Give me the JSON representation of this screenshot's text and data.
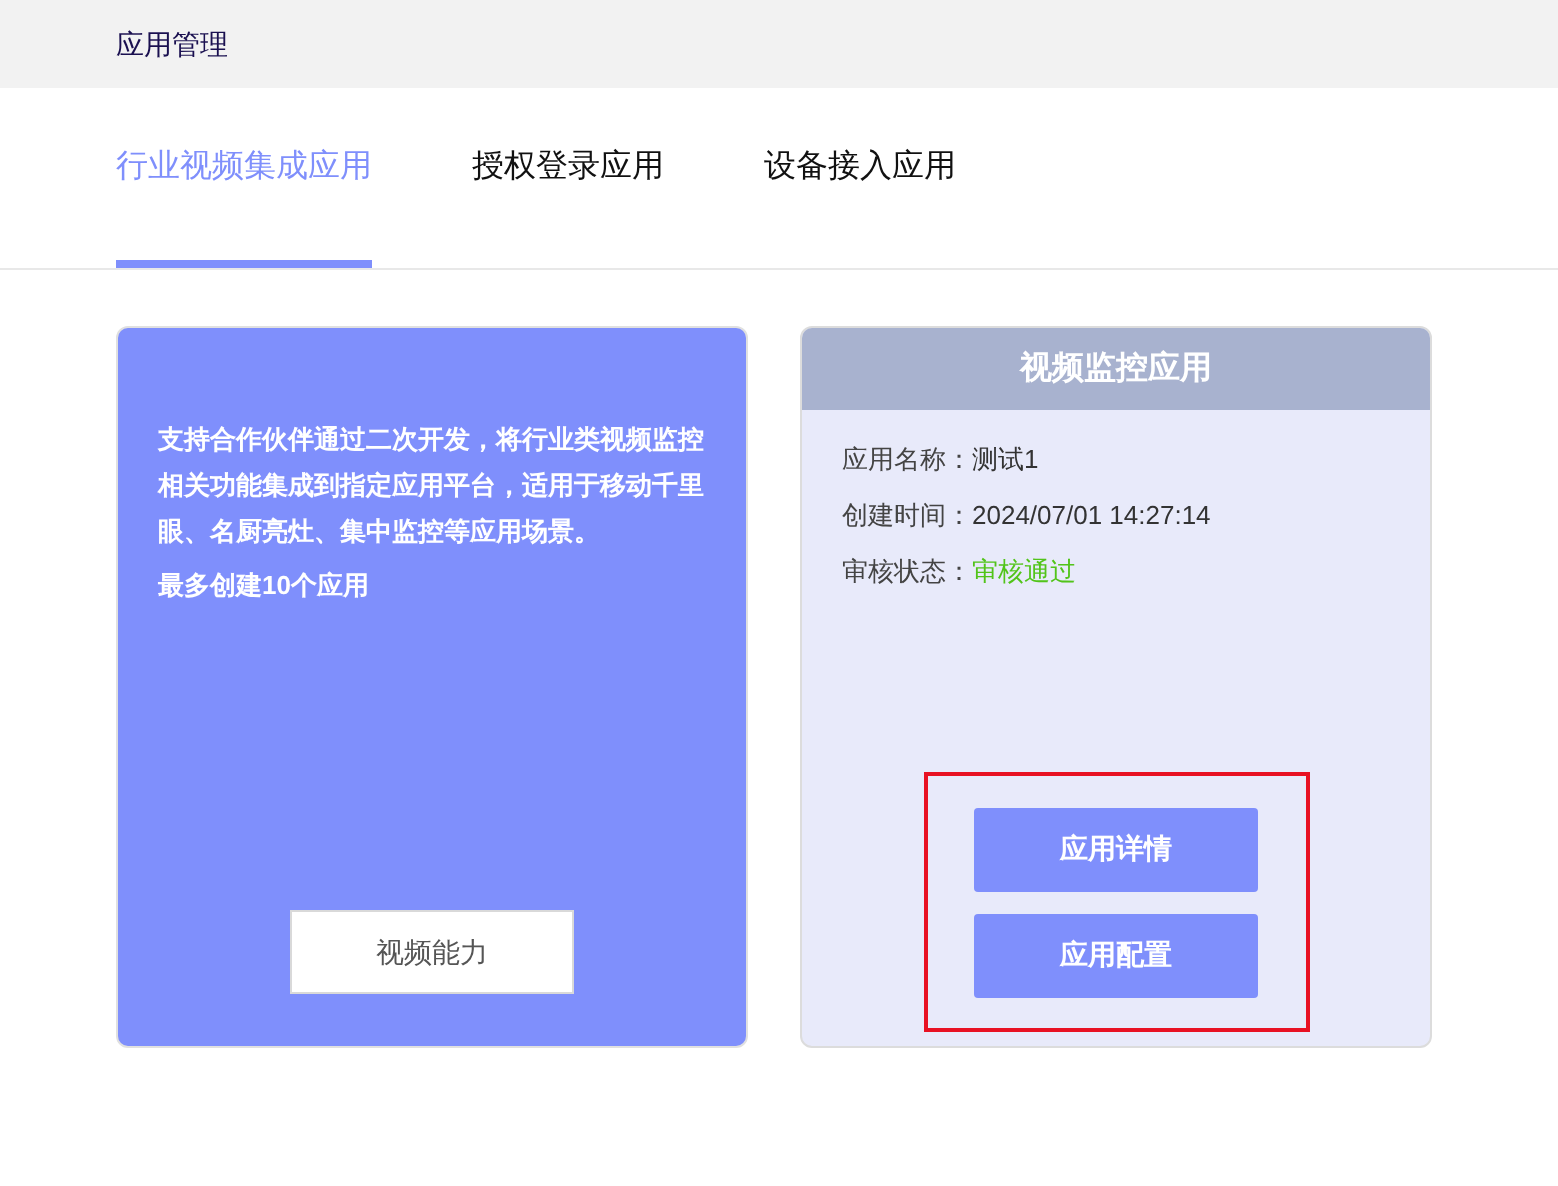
{
  "header": {
    "title": "应用管理"
  },
  "tabs": [
    {
      "label": "行业视频集成应用",
      "selected": true
    },
    {
      "label": "授权登录应用",
      "selected": false
    },
    {
      "label": "设备接入应用",
      "selected": false
    }
  ],
  "intro_card": {
    "description": "支持合作伙伴通过二次开发，将行业类视频监控相关功能集成到指定应用平台，适用于移动千里眼、名厨亮灶、集中监控等应用场景。",
    "limit": "最多创建10个应用",
    "button": "视频能力"
  },
  "app_card": {
    "title": "视频监控应用",
    "fields": [
      {
        "label": "应用名称：",
        "value": "测试1",
        "kind": "plain"
      },
      {
        "label": "创建时间：",
        "value": "2024/07/01 14:27:14",
        "kind": "plain"
      },
      {
        "label": "审核状态：",
        "value": "审核通过",
        "kind": "approved"
      }
    ],
    "buttons": [
      "应用详情",
      "应用配置"
    ],
    "highlighted": true
  }
}
